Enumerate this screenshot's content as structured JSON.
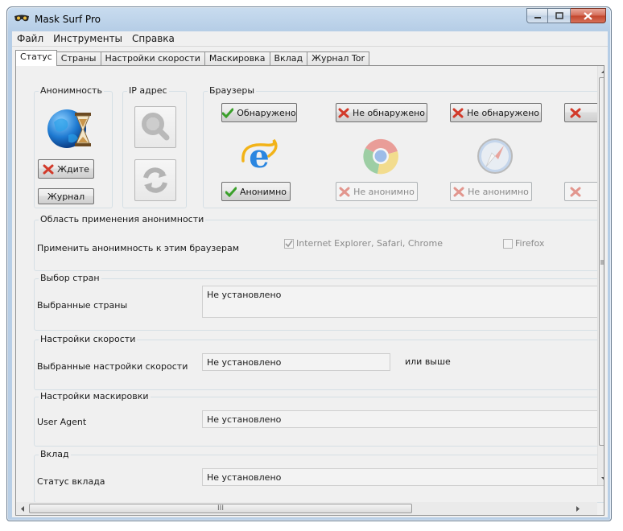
{
  "window": {
    "title": "Mask Surf Pro"
  },
  "menu": [
    "Файл",
    "Инструменты",
    "Справка"
  ],
  "tabs": [
    "Статус",
    "Страны",
    "Настройки скорости",
    "Маскировка",
    "Вклад",
    "Журнал Tor"
  ],
  "anonymity": {
    "label": "Анонимность",
    "wait_button": "Ждите",
    "log_button": "Журнал"
  },
  "ip": {
    "label": "IP адрес"
  },
  "browsers": {
    "label": "Браузеры",
    "items": [
      {
        "name": "internet-explorer",
        "detect": "Обнаружено",
        "detect_ok": true,
        "anon": "Анонимно",
        "anon_ok": true
      },
      {
        "name": "chrome",
        "detect": "Не обнаружено",
        "detect_ok": false,
        "anon": "Не анонимно",
        "anon_ok": false
      },
      {
        "name": "safari",
        "detect": "Не обнаружено",
        "detect_ok": false,
        "anon": "Не анонимно",
        "anon_ok": false
      }
    ]
  },
  "scope": {
    "label": "Область применения анонимности",
    "row_label": "Применить анонимность к этим браузерам",
    "option1": "Internet Explorer, Safari, Chrome",
    "option1_checked": true,
    "option2": "Firefox",
    "option2_checked": false
  },
  "countries": {
    "label": "Выбор стран",
    "row_label": "Выбранные страны",
    "value": "Не установлено"
  },
  "speed": {
    "label": "Настройки скорости",
    "row_label": "Выбранные настройки скорости",
    "value": "Не установлено",
    "suffix": "или выше"
  },
  "masking": {
    "label": "Настройки маскировки",
    "row_label": "User Agent",
    "value": "Не установлено"
  },
  "contribution": {
    "label": "Вклад",
    "row_label": "Статус вклада",
    "value": "Не установлено"
  },
  "scrollbar": {
    "grip": "III"
  },
  "colors": {
    "accent": "#2a6fd6",
    "ok": "#3aa02a",
    "fail": "#d23a2a"
  }
}
